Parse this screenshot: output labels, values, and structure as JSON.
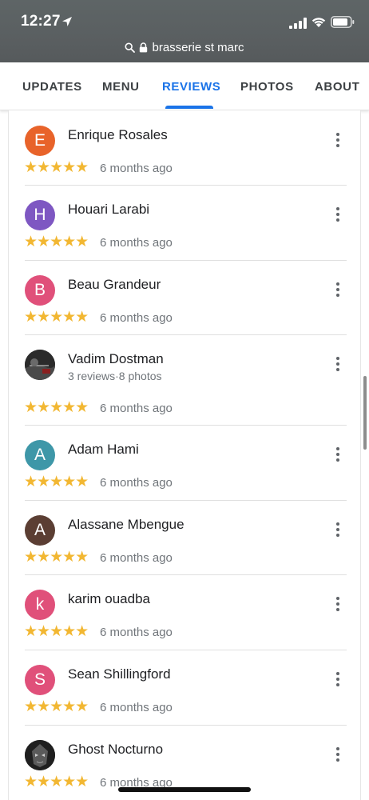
{
  "status": {
    "time": "12:27"
  },
  "url": {
    "domain": "brasserie st marc"
  },
  "tabs": [
    {
      "label": "UPDATES"
    },
    {
      "label": "MENU"
    },
    {
      "label": "REVIEWS"
    },
    {
      "label": "PHOTOS"
    },
    {
      "label": "ABOUT"
    }
  ],
  "reviews": [
    {
      "name": "Enrique Rosales",
      "initial": "E",
      "avatar_color": "#e8632a",
      "stars": "★★★★★",
      "time": "6 months ago"
    },
    {
      "name": "Houari Larabi",
      "initial": "H",
      "avatar_color": "#7e57c2",
      "stars": "★★★★★",
      "time": "6 months ago"
    },
    {
      "name": "Beau Grandeur",
      "initial": "B",
      "avatar_color": "#e0507a",
      "stars": "★★★★★",
      "time": "6 months ago"
    },
    {
      "name": "Vadim Dostman",
      "initial": "",
      "avatar_color": "#2a2a2a",
      "subline": "3 reviews·8 photos",
      "stars": "★★★★★",
      "time": "6 months ago"
    },
    {
      "name": "Adam Hami",
      "initial": "A",
      "avatar_color": "#3e97a8",
      "stars": "★★★★★",
      "time": "6 months ago"
    },
    {
      "name": "Alassane Mbengue",
      "initial": "A",
      "avatar_color": "#5b3e33",
      "stars": "★★★★★",
      "time": "6 months ago"
    },
    {
      "name": "karim ouadba",
      "initial": "k",
      "avatar_color": "#e0507a",
      "stars": "★★★★★",
      "time": "6 months ago"
    },
    {
      "name": "Sean Shillingford",
      "initial": "S",
      "avatar_color": "#e0507a",
      "stars": "★★★★★",
      "time": "6 months ago"
    },
    {
      "name": "Ghost Nocturno",
      "initial": "",
      "avatar_color": "#3a3a3a",
      "stars": "★★★★★",
      "time": "6 months ago"
    }
  ],
  "colors": {
    "accent": "#1a73e8",
    "star": "#f2b732",
    "secondary_text": "#70757a"
  }
}
